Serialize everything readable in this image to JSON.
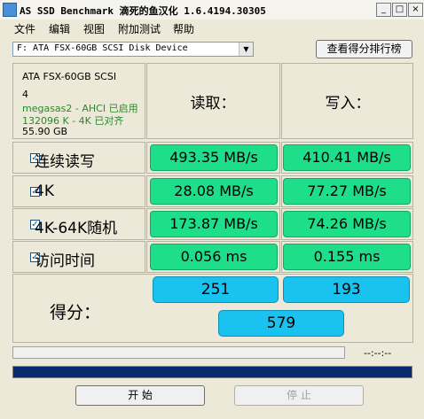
{
  "window": {
    "title": "AS SSD Benchmark 滴死的鱼汉化 1.6.4194.30305",
    "min": "_",
    "max": "□",
    "close": "×"
  },
  "menu": [
    "文件",
    "编辑",
    "视图",
    "附加测试",
    "帮助"
  ],
  "drive_select": {
    "value": "F: ATA FSX-60GB SCSI Disk Device",
    "arrow": "▼"
  },
  "ranking_button": "查看得分排行榜",
  "drive_info": {
    "model": "ATA FSX-60GB SCSI",
    "number": "4",
    "driver": "megasas2 - AHCI 已启用",
    "alignment": "132096 K - 4K 已对齐",
    "size": "55.90 GB"
  },
  "headers": {
    "read": "读取：",
    "write": "写入："
  },
  "rows": [
    {
      "label": "连续读写",
      "checked": "✓",
      "read": "493.35 MB/s",
      "write": "410.41 MB/s"
    },
    {
      "label": "4K",
      "checked": "✓",
      "read": "28.08 MB/s",
      "write": "77.27 MB/s"
    },
    {
      "label": "4K-64K随机",
      "checked": "✓",
      "read": "173.87 MB/s",
      "write": "74.26 MB/s"
    },
    {
      "label": "访问时间",
      "checked": "✓",
      "read": "0.056 ms",
      "write": "0.155 ms"
    }
  ],
  "score": {
    "label": "得分：",
    "read": "251",
    "write": "193",
    "total": "579"
  },
  "time_readout": "--:--:--",
  "progress_fraction": 1.0,
  "buttons": {
    "start": "开 始",
    "stop": "停 止"
  },
  "colors": {
    "result_green": "#1ede8a",
    "score_blue": "#1ac2f0",
    "progress": "#0a2a6e"
  }
}
